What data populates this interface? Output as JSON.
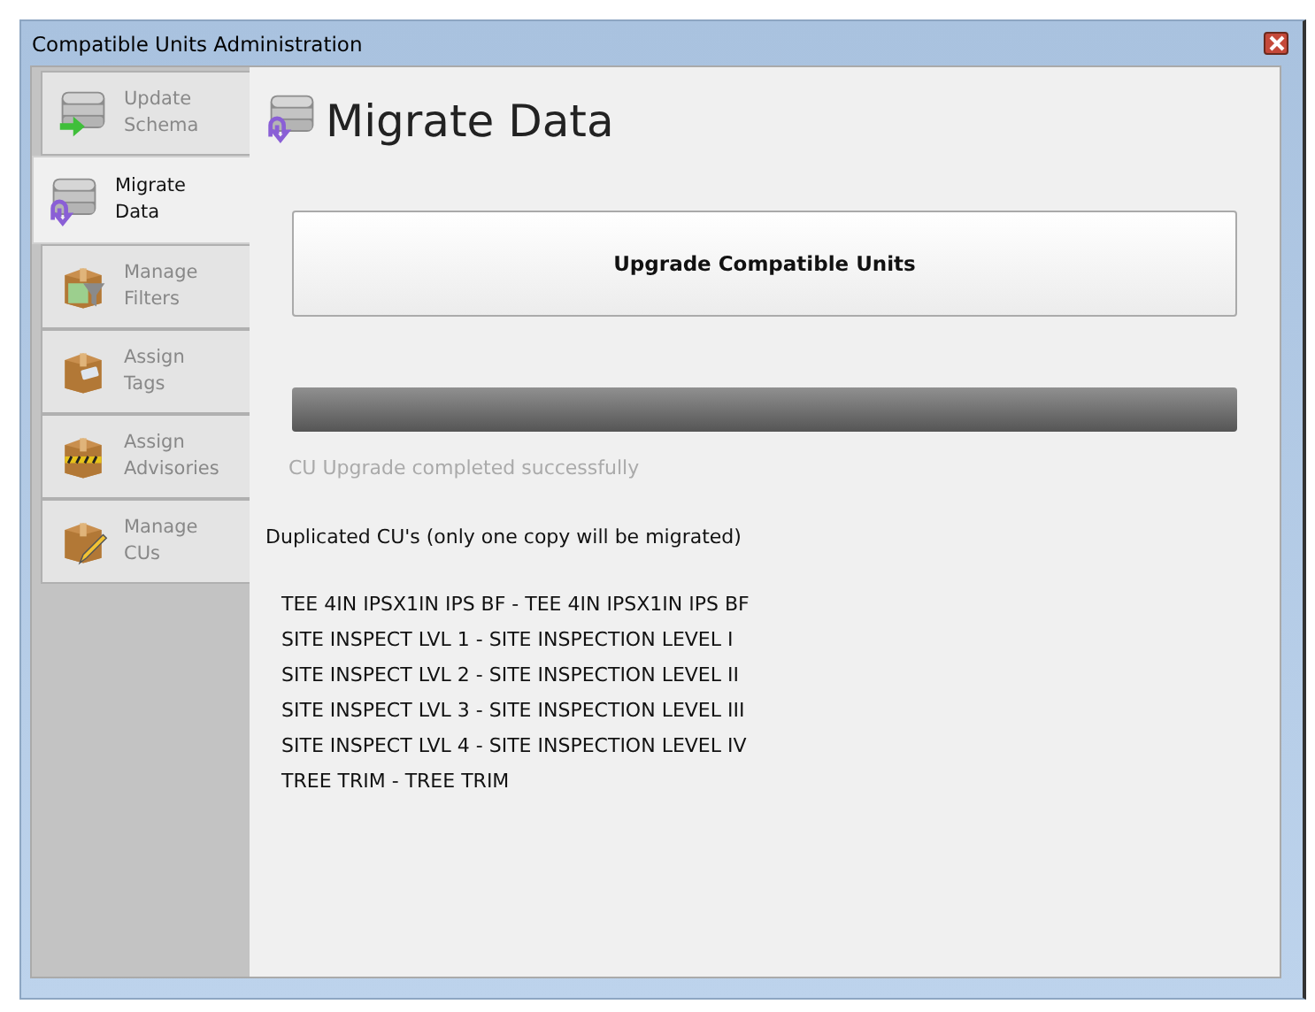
{
  "window": {
    "title": "Compatible Units Administration"
  },
  "sidebar": {
    "items": [
      {
        "label": "Update\nSchema",
        "selected": false
      },
      {
        "label": "Migrate\nData",
        "selected": true
      },
      {
        "label": "Manage\nFilters",
        "selected": false
      },
      {
        "label": "Assign\nTags",
        "selected": false
      },
      {
        "label": "Assign\nAdvisories",
        "selected": false
      },
      {
        "label": "Manage\nCUs",
        "selected": false
      }
    ]
  },
  "page": {
    "title": "Migrate Data",
    "upgrade_button": "Upgrade Compatible Units",
    "progress": {
      "level": 1
    },
    "status": "CU Upgrade completed successfully",
    "duplicates_heading": "Duplicated CU's (only one copy will be migrated)",
    "duplicates": [
      "TEE 4IN IPSX1IN IPS BF - TEE 4IN IPSX1IN IPS BF",
      "SITE INSPECT LVL 1 - SITE INSPECTION LEVEL I",
      "SITE INSPECT LVL 2 - SITE INSPECTION LEVEL II",
      "SITE INSPECT LVL 3 - SITE INSPECTION LEVEL III",
      "SITE INSPECT LVL 4 - SITE INSPECTION LEVEL IV",
      "TREE TRIM - TREE TRIM"
    ]
  }
}
